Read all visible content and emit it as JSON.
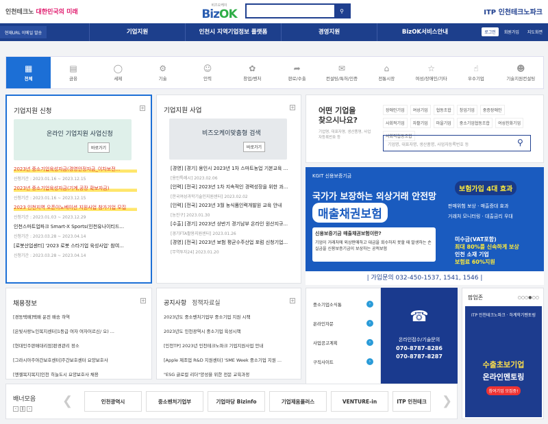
{
  "header": {
    "logo_left_a": "인천테크노",
    "logo_left_b": "대한민국의",
    "logo_left_c": "미래",
    "brand_small": "비즈오케이",
    "brand_a": "Biz",
    "brand_b": "OK",
    "right_logo": "ITP 인천테크노파크"
  },
  "nav": {
    "menu": "현재URL 이메일 발송",
    "items": [
      "기업지원",
      "인천시 지역기업정보 플랫폼",
      "경영지원",
      "BizOK서비스안내"
    ],
    "util": [
      "로그인",
      "회원가입",
      "지도화면"
    ]
  },
  "categories": [
    "전체",
    "금융",
    "세제",
    "기술",
    "인력",
    "창업/벤처",
    "판로/수출",
    "컨설팅/특허/인증",
    "전통시장",
    "여성/장애인/기타",
    "우수기업",
    "기술지원컨설팅"
  ],
  "support": {
    "title": "기업지원 신청",
    "banner": "온라인 기업지원 사업신청",
    "banner_btn": "바로가기",
    "items": [
      {
        "t": "2023년 중소기업육성자금(경영안정자금_이차보전...",
        "d": "신청기간 : 2023.01.16 ~ 2023.12.15"
      },
      {
        "t": "2023년 중소기업육성자금(기계,공장 확보자금)",
        "d": "신청기간 : 2023.01.16 ~ 2023.12.15"
      },
      {
        "t": "2023 인천지역 오픈이노베이션 지원사업 참가기업 모집",
        "d": "신청기간 : 2023.01.03 ~ 2023.12.29"
      },
      {
        "t": "인천스마트업파크 Smart-X Sports(인천유나이티드...",
        "d": "신청기간 : 2023.03.28 ~ 2023.04.14"
      },
      {
        "t": "[로봇산업센터] '2023 로봇 스타기업 육성사업' 참여...",
        "d": "신청기간 : 2023.03.28 ~ 2023.04.14"
      }
    ]
  },
  "business": {
    "title": "기업지원 사업",
    "banner": "비즈오케이맞춤형 검색",
    "banner_btn": "바로가기",
    "items": [
      {
        "t": "[경영] [경기] 용인시 2023년 1차 스마트농업 기본교육 ...",
        "d": "[용인특례시] 2023.02.06"
      },
      {
        "t": "[인력] [전국] 2023년 1차 지속적인 경력성장을 위한 과...",
        "d": "[한국여성과학기술인지원센터] 2023.02.02"
      },
      {
        "t": "[인력] [전국] 2023년 3월 농식품인력개발원 교육 안내",
        "d": "[농진구] 2023.01.30"
      },
      {
        "t": "[수출] [경기] 2023년 상반기 경기남부 온라인 원산지규...",
        "d": "[경기FTA활용지원센터] 2023.01.26"
      },
      {
        "t": "[경영] [전국] 2023년 보험 평균수주산업 포럼 신청기업...",
        "d": "[무역투자24] 2023.01.20"
      }
    ]
  },
  "find": {
    "title_a": "어떤 기업을",
    "title_b": "찾으시나요?",
    "sub": "기업명, 대표자명, 생산품명, 사업자등록번호 등",
    "tags": [
      "장애인기업",
      "여성기업",
      "협동조합",
      "창업기업",
      "중증장애인",
      "사회적기업",
      "자활기업",
      "마을기업",
      "중소기업협동조합",
      "여성친화기업",
      "사회적협동조합"
    ],
    "placeholder": "기업명, 대표자명, 생산품명, 사업자등록번호 등"
  },
  "ad": {
    "org": "KGIT 신용보증기금",
    "h1": "국가가 보장하는 외상거래 안전망",
    "h2": "매출채권보험",
    "h3": "신용보증기금 매출채권보험이란?",
    "h3b": "기업이 거래처에 외상판매하고 대금을 회수하지 못할 때 발생하는 손실금을 신용보증기금이 보상하는 공적보험",
    "h4": "보험가입 4대 효과",
    "effects": [
      "판매위험 보상",
      "매출증대 효과",
      "거래처 모니터링",
      "대출금리 우대"
    ],
    "h6a": "미수금(VAT포함)",
    "h6b": "최대 80%를 신속하게 보상",
    "h6c": "인천 소재 기업",
    "h6d": "보험료 60%지원",
    "contact": "| 가입문의 032-450-1537, 1541, 1546 |"
  },
  "jobs": {
    "title": "채용정보",
    "items": [
      "[경동택배]택배 운전 배송 하역",
      "[은빛사랑노인복지센터]1등급 여자 여자어르신/ 오)  ...",
      "[현대인주판매대리점]판경관리 정소",
      "[그라시아주야간보호센터]주간보호센터 요양보호사",
      "[엔젤복지복지]인천 히늘도시 요양보호사 채용"
    ]
  },
  "notice": {
    "tab_a": "공지사항",
    "tab_b": "정책자료실",
    "items": [
      "2023년도 중소벤처기업부 중소기업 지원 시책",
      "2023년도 인천광역시 중소기업 육성시책",
      "[인천TP] 2023년 인천테크노파크 기업지원사업 안내",
      "[Apple 제조업 R&D 지원센터] 'SME Week 중소기업 지원 ...",
      "\"ESG 글로컬 리더\"양성을 위한 전문 교육과정"
    ]
  },
  "sitelinks": [
    "중소기업소식통",
    "온라인자문",
    "사업공고계획",
    "구직사이트"
  ],
  "call": {
    "label": "온라인접수/기술문의",
    "nums": [
      "070-8787-8286",
      "070-8787-8287"
    ]
  },
  "popup": {
    "title": "팝업존",
    "a": "ITP 인천테크노파크 · 하계학기멘토링",
    "b": "수출초보기업",
    "c": "온라인멘토링",
    "d": "참여기업 모집중!"
  },
  "banners": {
    "title": "배너모음",
    "logos": [
      "인천광역시",
      "중소벤처기업부",
      "기업마당 Bizinfo",
      "기업제움플러스",
      "VENTURE-in",
      "ITP 인천테크"
    ]
  }
}
